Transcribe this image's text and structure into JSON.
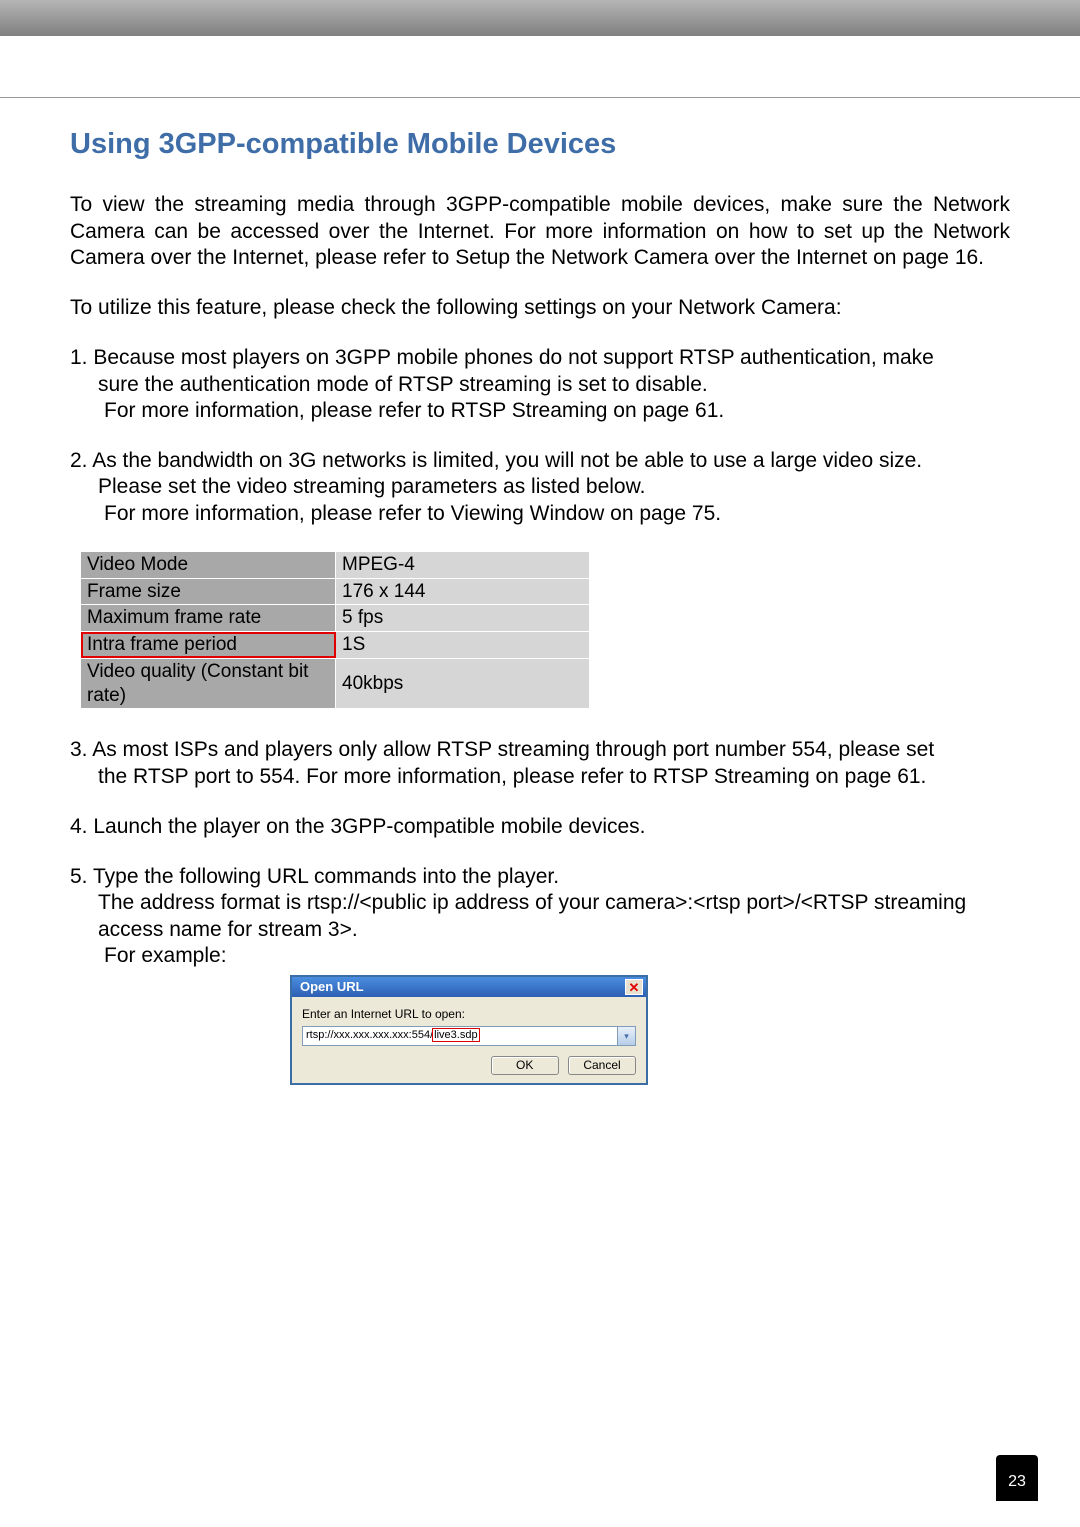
{
  "heading": "Using 3GPP-compatible Mobile Devices",
  "intro_para": "To view the streaming media through 3GPP-compatible mobile devices, make sure the Network Camera can be accessed over the Internet. For more information on how to set up the Network Camera over the Internet, please refer to Setup the Network Camera over the Internet on page 16.",
  "check_line": "To utilize this feature, please check the following settings on your Network Camera:",
  "item1_line1": "1. Because most players on 3GPP mobile phones do not support RTSP authentication, make",
  "item1_line2": "sure the authentication mode of RTSP streaming is set to disable.",
  "item1_line3": "For more information, please refer to RTSP Streaming on page 61.",
  "item2_line1": "2. As the bandwidth on 3G networks is limited, you will not be able to use a large video size.",
  "item2_line2": "Please set the video streaming parameters as listed below.",
  "item2_line3": "For more information, please refer to Viewing Window on page 75.",
  "settings": [
    {
      "label": "Video Mode",
      "value": "MPEG-4"
    },
    {
      "label": "Frame size",
      "value": "176 x 144"
    },
    {
      "label": "Maximum frame rate",
      "value": "5 fps"
    },
    {
      "label": "Intra frame period",
      "value": "1S"
    },
    {
      "label": "Video quality (Constant bit rate)",
      "value": "40kbps"
    }
  ],
  "item3_line1": "3. As most ISPs and players only allow RTSP streaming through port number 554, please set",
  "item3_line2": "the RTSP port to 554. For more information, please refer to RTSP Streaming on page 61.",
  "item4": "4. Launch the player on the 3GPP-compatible mobile devices.",
  "item5_line1": "5. Type the following URL commands into the player.",
  "item5_line2": "The address format is rtsp://<public ip address of your camera>:<rtsp port>/<RTSP streaming",
  "item5_line3": "access name for stream 3>.",
  "item5_line4": "For example:",
  "dialog": {
    "title": "Open URL",
    "label": "Enter an Internet URL to open:",
    "url_prefix": "rtsp://xxx.xxx.xxx.xxx:554/",
    "url_highlight": "live3.sdp",
    "ok": "OK",
    "cancel": "Cancel"
  },
  "page_number": "23"
}
